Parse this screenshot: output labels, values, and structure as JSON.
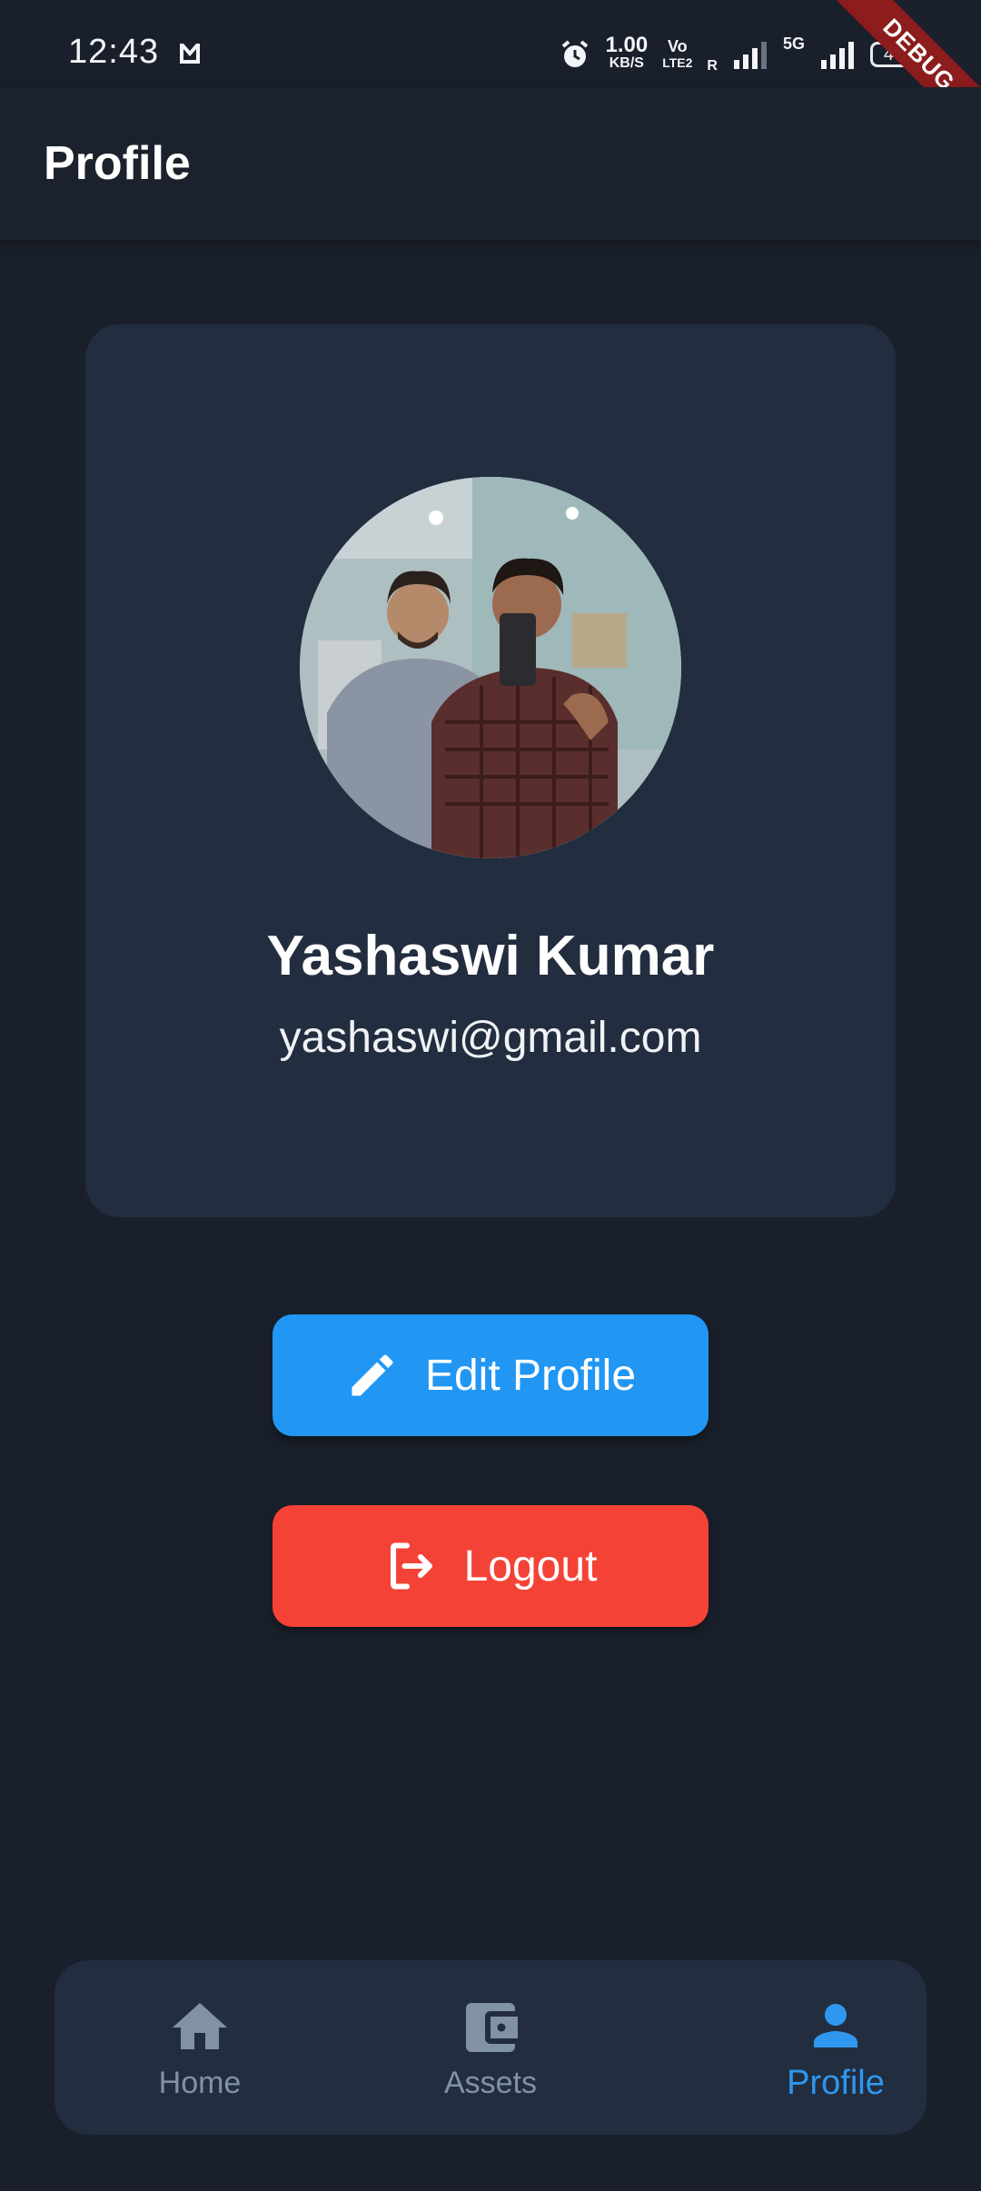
{
  "status_bar": {
    "time": "12:43",
    "net_speed_value": "1.00",
    "net_speed_unit": "KB/S",
    "volte_top": "Vo",
    "volte_bottom": "LTE2",
    "roaming": "R",
    "network": "5G",
    "battery": "45"
  },
  "debug_banner": "DEBUG",
  "app_bar": {
    "title": "Profile"
  },
  "profile": {
    "name": "Yashaswi Kumar",
    "email": "yashaswi@gmail.com"
  },
  "buttons": {
    "edit_label": "Edit Profile",
    "logout_label": "Logout"
  },
  "nav": {
    "items": [
      {
        "label": "Home",
        "icon": "home-icon"
      },
      {
        "label": "Assets",
        "icon": "wallet-icon"
      },
      {
        "label": "Profile",
        "icon": "person-icon",
        "active": true
      }
    ]
  },
  "colors": {
    "background": "#1a202b",
    "card": "#222d3f",
    "primary": "#2196f3",
    "danger": "#f44336",
    "nav_active": "#2f97ee",
    "nav_inactive": "#8192a6"
  }
}
